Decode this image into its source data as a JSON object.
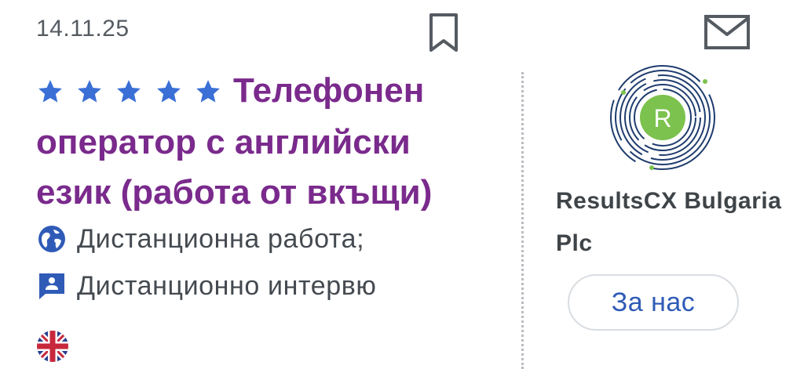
{
  "job": {
    "date": "14.11.25",
    "rating_stars": 5,
    "title": "Телефонен оператор с английски език (работа от вкъщи)",
    "title_color": "#7a2a8c",
    "star_color": "#3a6fd6",
    "location": "Дистанционна работа;",
    "interview": "Дистанционно интервю",
    "language_flag": "uk-flag-icon"
  },
  "company": {
    "name": "ResultsCX Bulgaria Plc",
    "logo_letter": "R",
    "logo_color": "#7cc24e",
    "about_label": "За нас"
  },
  "icons": {
    "bookmark": "bookmark-icon",
    "mail": "mail-icon",
    "location": "globe-icon",
    "interview": "interview-icon"
  }
}
